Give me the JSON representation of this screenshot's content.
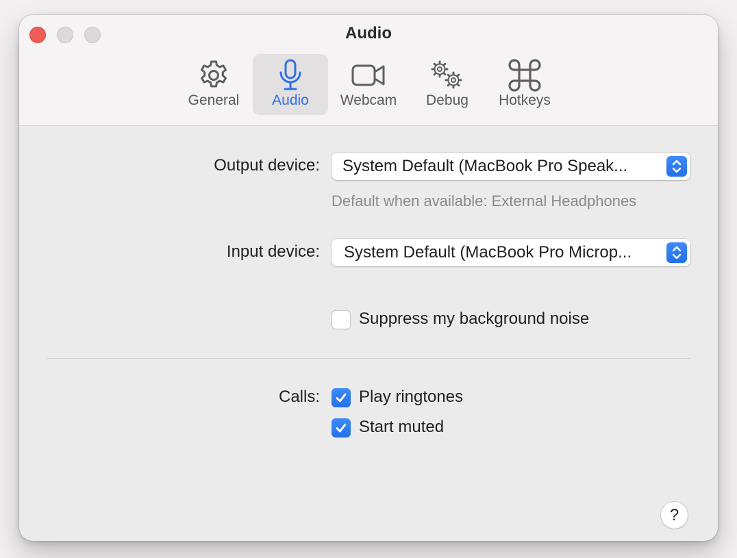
{
  "window": {
    "title": "Audio"
  },
  "tabs": [
    {
      "label": "General",
      "icon": "gear-icon",
      "active": false
    },
    {
      "label": "Audio",
      "icon": "microphone-icon",
      "active": true
    },
    {
      "label": "Webcam",
      "icon": "video-camera-icon",
      "active": false
    },
    {
      "label": "Debug",
      "icon": "gears-icon",
      "active": false
    },
    {
      "label": "Hotkeys",
      "icon": "command-key-icon",
      "active": false
    }
  ],
  "audio": {
    "output_label": "Output device:",
    "output_value": "System Default (MacBook Pro Speak...",
    "output_hint": "Default when available: External Headphones",
    "input_label": "Input device:",
    "input_value": "System Default (MacBook Pro Microp...",
    "noise_label": "Suppress my background noise",
    "noise_checked": false
  },
  "calls": {
    "label": "Calls:",
    "ringtones_label": "Play ringtones",
    "ringtones_checked": true,
    "muted_label": "Start muted",
    "muted_checked": true
  },
  "help": {
    "label": "?"
  },
  "colors": {
    "accent": "#2f6fe6",
    "close": "#ee5e57"
  }
}
